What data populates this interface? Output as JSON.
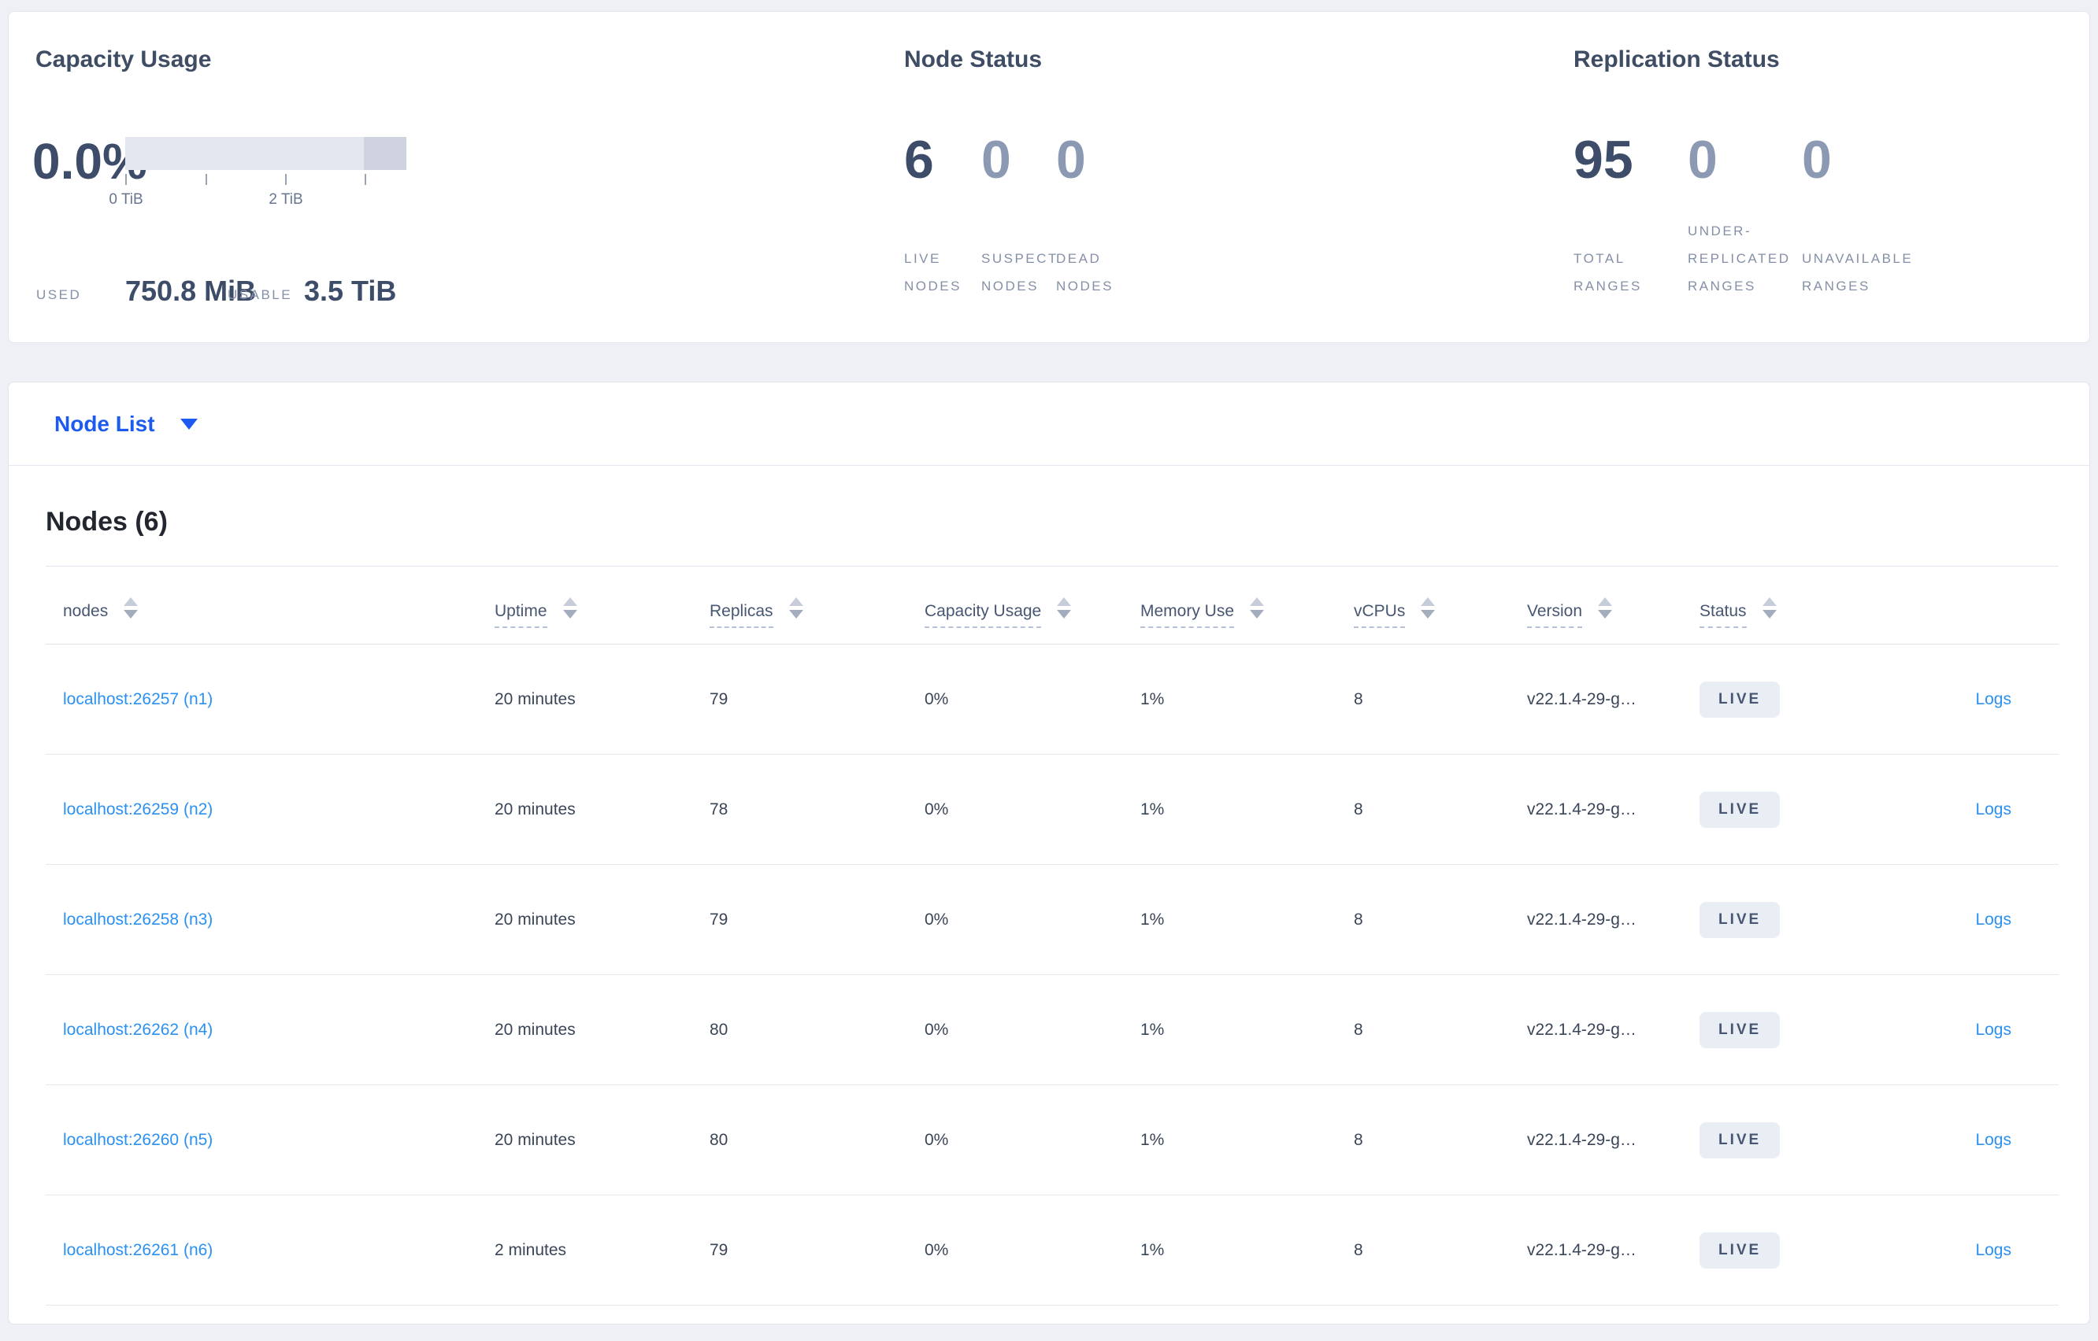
{
  "capacity": {
    "title": "Capacity Usage",
    "percent": "0.0%",
    "used_label": "USED",
    "used_value": "750.8 MiB",
    "usable_label": "USABLE",
    "usable_value": "3.5 TiB",
    "tick_labels": [
      "0 TiB",
      "2 TiB"
    ],
    "bar": {
      "track_color": "#e3e6ee",
      "end_segment_color": "#ced3df",
      "end_segment_fraction": 0.15
    }
  },
  "node_status": {
    "title": "Node Status",
    "stats": [
      {
        "value": "6",
        "label": "LIVE\nNODES"
      },
      {
        "value": "0",
        "label": "SUSPECT\nNODES"
      },
      {
        "value": "0",
        "label": "DEAD\nNODES"
      }
    ]
  },
  "replication_status": {
    "title": "Replication Status",
    "stats": [
      {
        "value": "95",
        "label": "TOTAL\nRANGES"
      },
      {
        "value": "0",
        "label": "UNDER-\nREPLICATED\nRANGES"
      },
      {
        "value": "0",
        "label": "UNAVAILABLE\nRANGES"
      }
    ]
  },
  "node_list": {
    "label": "Node List"
  },
  "table": {
    "title": "Nodes (6)",
    "columns": [
      {
        "label": "nodes"
      },
      {
        "label": "Uptime"
      },
      {
        "label": "Replicas"
      },
      {
        "label": "Capacity Usage"
      },
      {
        "label": "Memory Use"
      },
      {
        "label": "vCPUs"
      },
      {
        "label": "Version"
      },
      {
        "label": "Status"
      }
    ],
    "rows": [
      {
        "node": "localhost:26257 (n1)",
        "uptime": "20 minutes",
        "replicas": "79",
        "capacity": "0%",
        "memory": "1%",
        "vcpus": "8",
        "version": "v22.1.4-29-g…",
        "status": "LIVE",
        "logs": "Logs"
      },
      {
        "node": "localhost:26259 (n2)",
        "uptime": "20 minutes",
        "replicas": "78",
        "capacity": "0%",
        "memory": "1%",
        "vcpus": "8",
        "version": "v22.1.4-29-g…",
        "status": "LIVE",
        "logs": "Logs"
      },
      {
        "node": "localhost:26258 (n3)",
        "uptime": "20 minutes",
        "replicas": "79",
        "capacity": "0%",
        "memory": "1%",
        "vcpus": "8",
        "version": "v22.1.4-29-g…",
        "status": "LIVE",
        "logs": "Logs"
      },
      {
        "node": "localhost:26262 (n4)",
        "uptime": "20 minutes",
        "replicas": "80",
        "capacity": "0%",
        "memory": "1%",
        "vcpus": "8",
        "version": "v22.1.4-29-g…",
        "status": "LIVE",
        "logs": "Logs"
      },
      {
        "node": "localhost:26260 (n5)",
        "uptime": "20 minutes",
        "replicas": "80",
        "capacity": "0%",
        "memory": "1%",
        "vcpus": "8",
        "version": "v22.1.4-29-g…",
        "status": "LIVE",
        "logs": "Logs"
      },
      {
        "node": "localhost:26261 (n6)",
        "uptime": "2 minutes",
        "replicas": "79",
        "capacity": "0%",
        "memory": "1%",
        "vcpus": "8",
        "version": "v22.1.4-29-g…",
        "status": "LIVE",
        "logs": "Logs"
      }
    ]
  },
  "colors": {
    "page_background": "#eef0f5",
    "card_border": "#e2e6ec",
    "primary_number": "#3d4d69",
    "secondary_number": "#8b99b3",
    "stat_label": "#8490a8",
    "node_list_blue": "#1d5bf0",
    "link_blue": "#2a90f2",
    "badge_background": "#e9edf4",
    "badge_text": "#475672"
  }
}
